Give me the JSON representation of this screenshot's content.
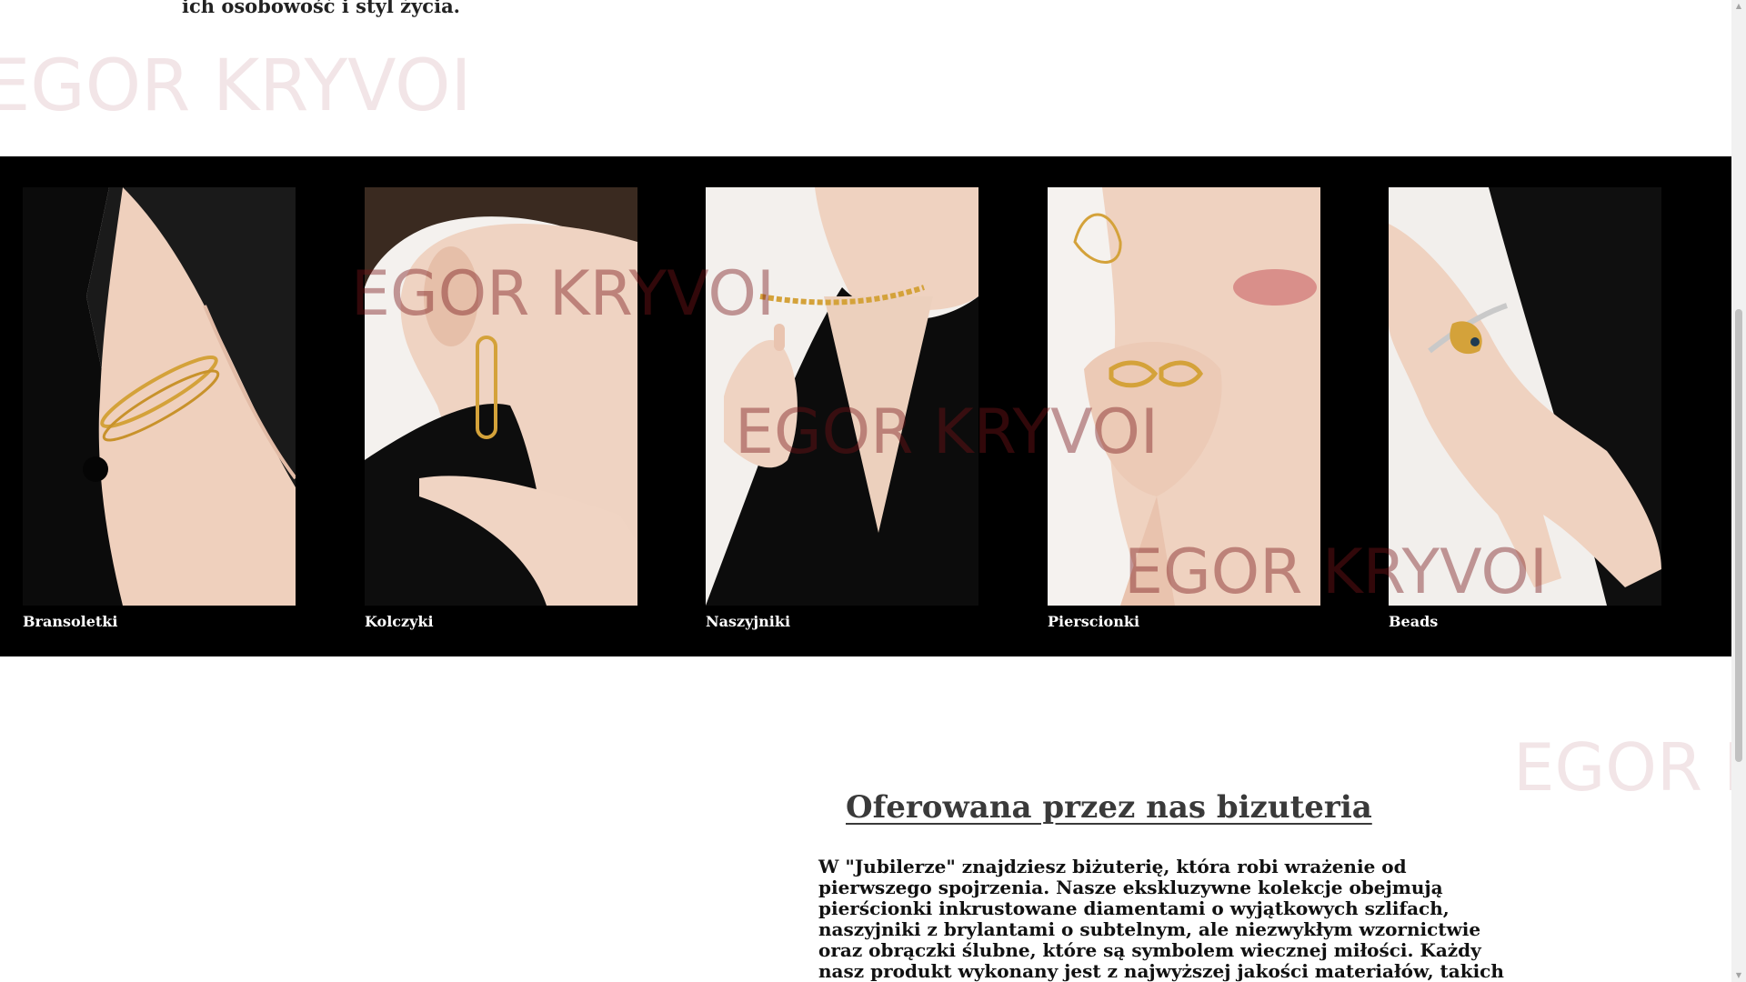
{
  "intro": {
    "text": "ich osobowość i styl życia."
  },
  "watermark": {
    "text": "EGOR KRYVOI"
  },
  "gallery": {
    "items": [
      {
        "label": "Bransoletki"
      },
      {
        "label": "Kolczyki"
      },
      {
        "label": "Naszyjniki"
      },
      {
        "label": "Pierscionki"
      },
      {
        "label": "Beads"
      }
    ]
  },
  "section": {
    "title": "Oferowana przez nas bizuteria",
    "body": "W \"Jubilerze\" znajdziesz biżuterię, która robi wrażenie od pierwszego spojrzenia. Nasze ekskluzywne kolekcje obejmują pierścionki inkrustowane diamentami o wyjątkowych szlifach, naszyjniki z brylantami o subtelnym, ale niezwykłym wzornictwie oraz obrączki ślubne, które są symbolem wiecznej miłości. Każdy nasz produkt wykonany jest z najwyższej jakości materiałów, takich jak platyna i"
  },
  "colors": {
    "gallery_background": "#000000",
    "watermark_light": "#f2e5e7",
    "watermark_dark": "#781419",
    "gold": "#d4a23a",
    "skin": "#efd2c0"
  },
  "icons": {
    "scroll_up": "triangle-up",
    "scroll_down": "triangle-down"
  }
}
